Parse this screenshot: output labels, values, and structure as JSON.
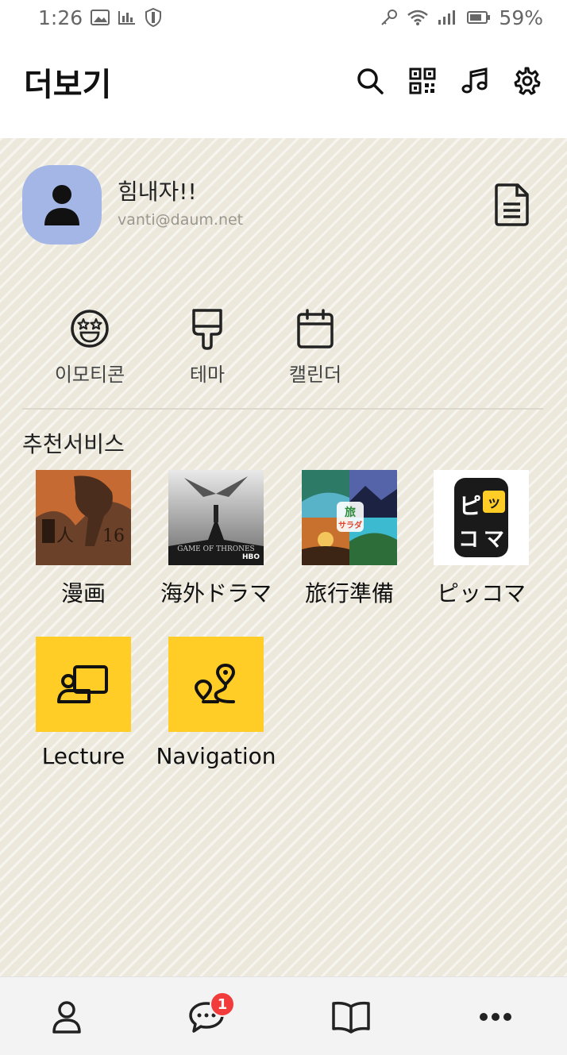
{
  "status_bar": {
    "time": "1:26",
    "battery": "59%"
  },
  "header": {
    "title": "더보기"
  },
  "profile": {
    "name": "힘내자!!",
    "email": "vanti@daum.net"
  },
  "quick_actions": [
    {
      "label": "이모티콘",
      "icon": "emoticon-icon"
    },
    {
      "label": "테마",
      "icon": "brush-icon"
    },
    {
      "label": "캘린더",
      "icon": "calendar-icon"
    }
  ],
  "recommended": {
    "title": "추천서비스",
    "items": [
      {
        "label": "漫画"
      },
      {
        "label": "海外ドラマ"
      },
      {
        "label": "旅行準備"
      },
      {
        "label": "ピッコマ"
      },
      {
        "label": "Lecture"
      },
      {
        "label": "Navigation"
      }
    ]
  },
  "tabs": {
    "chat_badge": "1"
  },
  "colors": {
    "accent_yellow": "#ffcd25",
    "avatar_bg": "#a3b6e6",
    "badge_red": "#f23c3c"
  }
}
